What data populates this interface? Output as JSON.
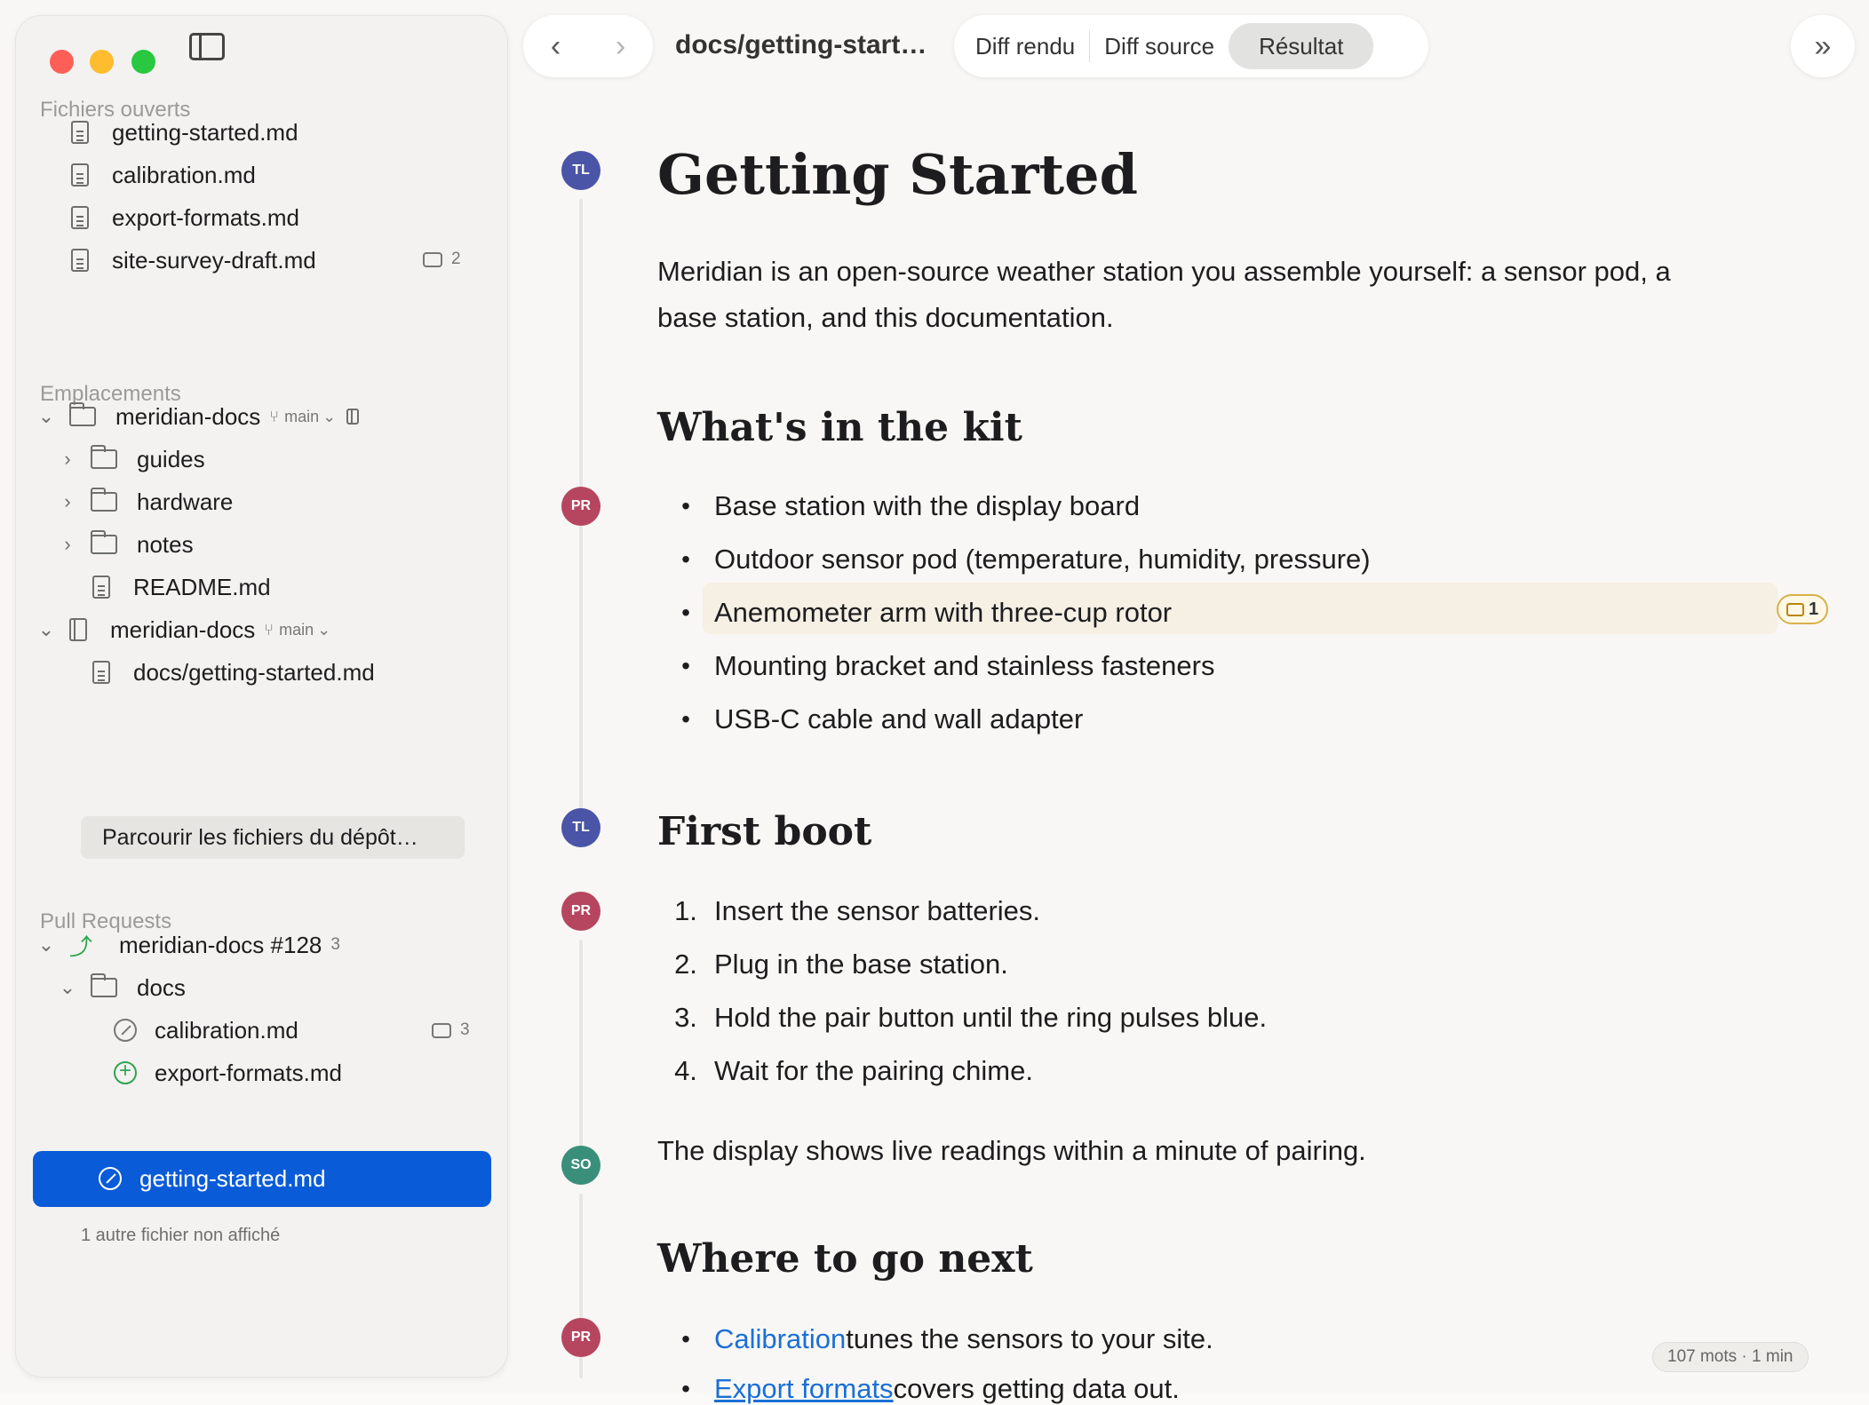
{
  "sidebar": {
    "open_files_title": "Fichiers ouverts",
    "open_files": [
      {
        "name": "getting-started.md"
      },
      {
        "name": "calibration.md"
      },
      {
        "name": "export-formats.md"
      },
      {
        "name": "site-survey-draft.md",
        "comments": "2"
      }
    ],
    "locations_title": "Emplacements",
    "locations": [
      {
        "name": "meridian-docs",
        "branch": "main",
        "children": [
          "guides",
          "hardware",
          "notes",
          "README.md"
        ]
      },
      {
        "name": "meridian-docs",
        "branch": "main",
        "children": [
          "docs/getting-started.md"
        ]
      }
    ],
    "browse_button": "Parcourir les fichiers du dépôt…",
    "pull_requests_title": "Pull Requests",
    "pull_request": {
      "name": "meridian-docs #128",
      "count": "3",
      "folder": "docs",
      "files": [
        {
          "name": "calibration.md",
          "comments": "3"
        },
        {
          "name": "export-formats.md"
        },
        {
          "name": "getting-started.md"
        }
      ]
    },
    "hidden_note": "1 autre fichier non affiché"
  },
  "toolbar": {
    "doc_title": "docs/getting-start…",
    "tabs": [
      "Diff rendu",
      "Diff source",
      "Résultat"
    ],
    "active_tab": "Résultat"
  },
  "document": {
    "title": "Getting Started",
    "intro_line1": "Meridian is an open-source weather station you assemble yourself: a sensor pod, a",
    "intro_line2": "base station, and this documentation.",
    "kit_heading": "What's in the kit",
    "kit_items": [
      "Base station with the display board",
      "Outdoor sensor pod (temperature, humidity, pressure)",
      "Anemometer arm with three-cup rotor",
      "Mounting bracket and stainless fasteners",
      "USB-C cable and wall adapter"
    ],
    "kit_comment_count": "1",
    "boot_heading": "First boot",
    "boot_steps": [
      "Insert the sensor batteries.",
      "Plug in the base station.",
      "Hold the pair button until the ring pulses blue.",
      "Wait for the pairing chime."
    ],
    "boot_numbers": [
      "1.",
      "2.",
      "3.",
      "4."
    ],
    "display_para": "The display shows live readings within a minute of pairing.",
    "next_heading": "Where to go next",
    "next_items": [
      {
        "link": "Calibration",
        "text": " tunes the sensors to your site."
      },
      {
        "link": "Export formats",
        "text": " covers getting data out."
      }
    ],
    "avatars": {
      "tl": "TL",
      "pr": "PR",
      "so": "SO"
    }
  },
  "status": {
    "word_count": "107 mots · 1 min"
  },
  "colors": {
    "accent": "#0a5bd8",
    "link": "#1a6fd6",
    "av_tl": "#4a55a8",
    "av_pr": "#b6465f",
    "av_so": "#3a8f7a"
  }
}
